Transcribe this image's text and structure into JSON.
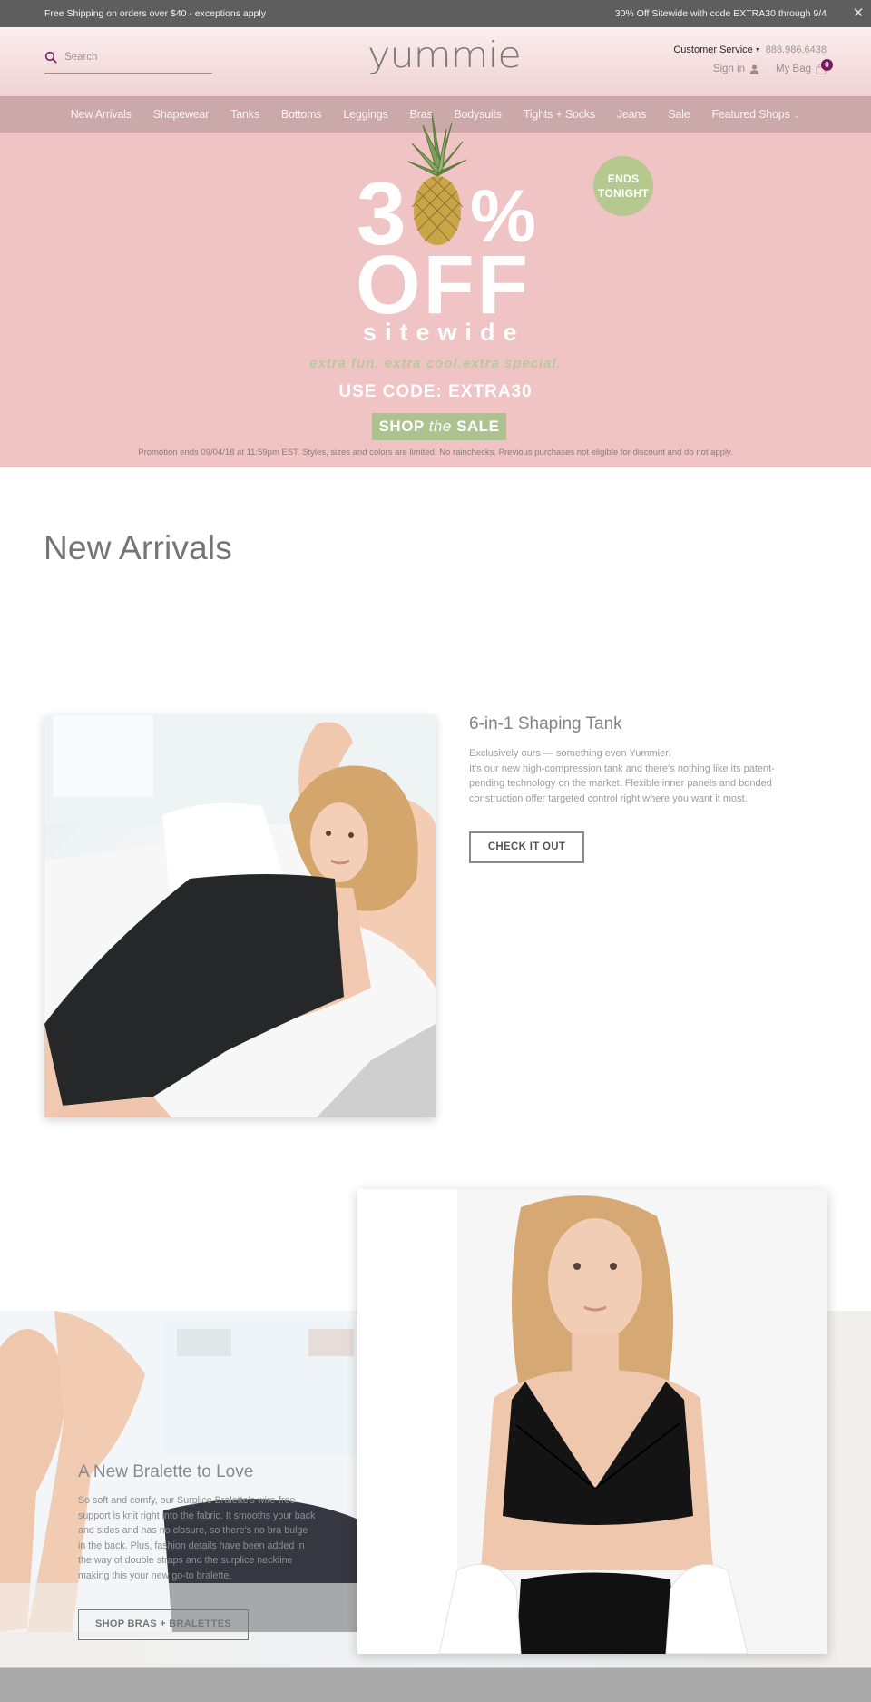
{
  "announcement": {
    "left_text": "Free Shipping on orders over $40 - exceptions apply",
    "right_text": "30% Off Sitewide with code EXTRA30 through 9/4",
    "close_icon": "close-icon"
  },
  "header": {
    "search_placeholder": "Search",
    "search_value": "",
    "logo": "yummie",
    "customer_service_label": "Customer Service",
    "phone": "888.986.6438",
    "sign_in_label": "Sign in",
    "bag_label": "My Bag",
    "bag_count": "0",
    "colors": {
      "accent": "#7b1a5d",
      "header_top": "#fbeeee",
      "header_bottom": "#f0d2d3"
    }
  },
  "nav": {
    "items": [
      {
        "label": "New Arrivals"
      },
      {
        "label": "Shapewear"
      },
      {
        "label": "Tanks"
      },
      {
        "label": "Bottoms"
      },
      {
        "label": "Leggings"
      },
      {
        "label": "Bras"
      },
      {
        "label": "Bodysuits"
      },
      {
        "label": "Tights + Socks"
      },
      {
        "label": "Jeans"
      },
      {
        "label": "Sale"
      },
      {
        "label": "Featured Shops"
      }
    ],
    "background": "#cba8a9"
  },
  "hero": {
    "digit_three": "3",
    "percent": "%",
    "off": "OFF",
    "sitewide": "sitewide",
    "tagline": "extra fun. extra cool.extra special.",
    "code_text": "USE CODE: EXTRA30",
    "shop_button": {
      "pre": "SHOP",
      "mid": "the",
      "post": "SALE"
    },
    "ends_badge": {
      "line1": "ENDS",
      "line2": "TONIGHT"
    },
    "fine_print": "Promotion ends 09/04/18 at 11:59pm EST. Styles, sizes and colors are limited. No rainchecks. Previous purchases not eligible for discount and do not apply.",
    "colors": {
      "background": "#f0c3c4",
      "green": "#adc38f"
    }
  },
  "new_arrivals": {
    "title": "New Arrivals",
    "feature1": {
      "title": "6-in-1 Shaping Tank",
      "line1": "Exclusively ours — something even Yummier!",
      "line2": "It's our new high-compression tank and there's nothing like its patent-pending technology on the market. Flexible inner panels and bonded construction offer targeted control right where you want it most.",
      "button": "CHECK IT OUT",
      "image": "woman-black-shaping-tank-photo"
    },
    "feature2": {
      "title": "A New Bralette to Love",
      "description": "So soft and comfy, our Surplice Bralette's wire-free support is knit right into the fabric. It smooths your back and sides and has no closure, so there's no bra bulge in the back. Plus, fashion details have been added in the way of double straps and the surplice neckline making this your new go-to bralette.",
      "button": "SHOP BRAS + BRALETTES",
      "image": "woman-black-bralette-photo",
      "background_image": "legs-on-sofa-photo"
    }
  }
}
